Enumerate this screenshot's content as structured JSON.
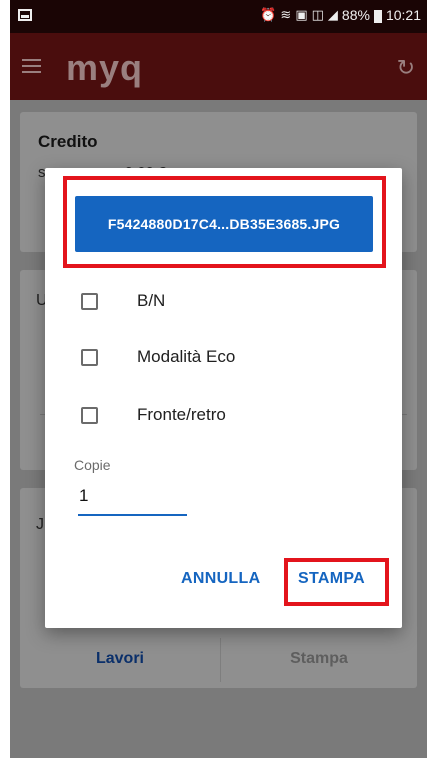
{
  "status_bar": {
    "battery_percent": "88%",
    "time": "10:21",
    "icons": [
      "image-icon",
      "alarm-icon",
      "wifi-icon",
      "nfc-icon",
      "sim-icon",
      "signal-icon",
      "battery-icon"
    ]
  },
  "app_bar": {
    "logo_text": "myq",
    "menu_icon": "hamburger-menu-icon",
    "refresh_icon": "refresh-icon"
  },
  "background": {
    "credit_card": {
      "title": "Credito",
      "subtitle": "s...................0.00 €"
    },
    "card2_letter": "U",
    "card3_letter": "J",
    "tabs": {
      "lavori": "Lavori",
      "stampa": "Stampa"
    }
  },
  "dialog": {
    "file_name": "F5424880D17C4...DB35E3685.JPG",
    "options": [
      {
        "label": "B/N",
        "checked": false
      },
      {
        "label": "Modalità Eco",
        "checked": false
      },
      {
        "label": "Fronte/retro",
        "checked": false
      }
    ],
    "copies": {
      "label": "Copie",
      "value": "1"
    },
    "buttons": {
      "cancel": "ANNULLA",
      "print": "STAMPA"
    }
  },
  "colors": {
    "accent": "#1565c0",
    "highlight": "#e3141c",
    "app_bar": "#4a0d0d"
  }
}
